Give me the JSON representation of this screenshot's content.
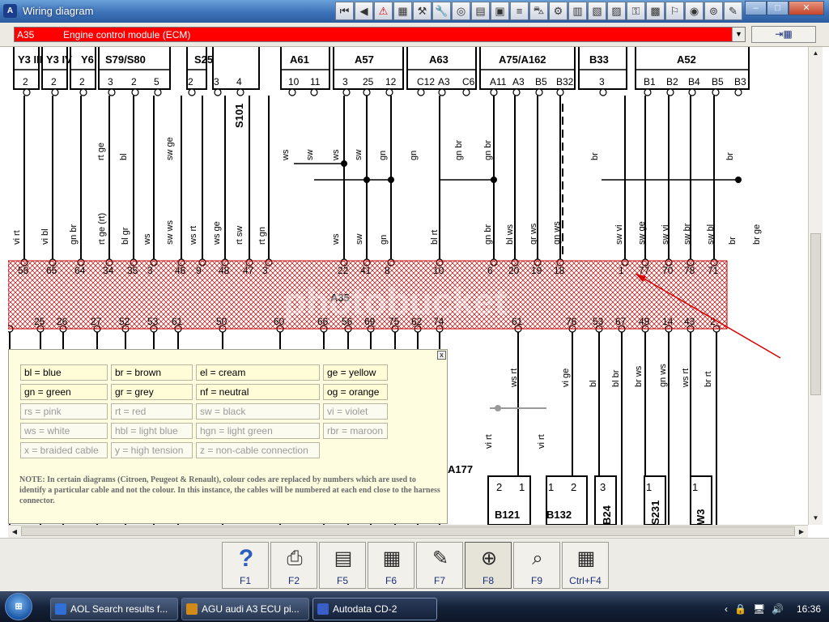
{
  "window": {
    "title": "Wiring diagram",
    "app_icon": "autodata-icon"
  },
  "toolbar_icons": [
    "first-icon",
    "prev-icon",
    "warning-icon",
    "map-icon",
    "tool-icon",
    "wrench-icon",
    "gauge-icon",
    "book-icon",
    "battery-icon",
    "filter-icon",
    "car-icon",
    "engine-icon",
    "manual-icon",
    "ecu-icon",
    "connector-icon",
    "key-icon",
    "diagram-icon",
    "service-icon",
    "brake-icon",
    "tyre-icon",
    "note-icon"
  ],
  "window_controls": {
    "minimize": "–",
    "maximize": "□",
    "close": "✕"
  },
  "component_select": {
    "code": "A35",
    "name": "Engine control module (ECM)",
    "arrow": "▼"
  },
  "exit_button": {
    "label": "⇥▦"
  },
  "diagram": {
    "ecu_label": "A35",
    "watermark": "photobucket",
    "top_headers": [
      {
        "text": "Y3 III"
      },
      {
        "text": "Y3 IV"
      },
      {
        "text": "Y6"
      },
      {
        "text": "S79/S80"
      },
      {
        "text": "S25"
      },
      {
        "text": "A61"
      },
      {
        "text": "A57"
      },
      {
        "text": "A63"
      },
      {
        "text": "A75/A162"
      },
      {
        "text": "B33"
      },
      {
        "text": "A52"
      }
    ],
    "side_label": "S101",
    "top_connector_pins": [
      "2",
      "2",
      "2",
      "3",
      "2",
      "5",
      "2",
      "3",
      "4",
      "10",
      "11",
      "3",
      "25",
      "12",
      "C12",
      "A3",
      "C6",
      "A11",
      "A3",
      "B5",
      "B32",
      "3",
      "B1",
      "B2",
      "B4",
      "B5",
      "B3"
    ],
    "upper_wire_colors": [
      "rt ge",
      "bl",
      "sw ge",
      "ws",
      "sw",
      "ws",
      "sw",
      "gn",
      "gn",
      "gn br",
      "gn br",
      "br",
      "br"
    ],
    "lower_wire_colors": [
      "vi rt",
      "vi bl",
      "gn br",
      "rt ge (rt)",
      "bl gr",
      "ws",
      "sw ws",
      "ws rt",
      "ws ge",
      "rt sw",
      "rt gn",
      "ws",
      "sw",
      "gn",
      "bl rt",
      "gn br",
      "bl ws",
      "gr ws",
      "gn ws",
      "sw vi",
      "sw ge",
      "sw vi",
      "sw br",
      "sw bl",
      "br",
      "br ge"
    ],
    "ecu_top_pins": [
      "58",
      "65",
      "64",
      "34",
      "35",
      "3",
      "46",
      "9",
      "48",
      "47",
      "3",
      "22",
      "41",
      "8",
      "10",
      "6",
      "20",
      "19",
      "18",
      "1",
      "77",
      "70",
      "78",
      "71"
    ],
    "ecu_bottom_pins": [
      "3",
      "25",
      "26",
      "27",
      "52",
      "53",
      "61",
      "50",
      "60",
      "66",
      "56",
      "69",
      "75",
      "62",
      "74",
      "61",
      "76",
      "53",
      "67",
      "49",
      "14",
      "43",
      "2"
    ],
    "below_wire_colors": [
      "ws rt",
      "vi ge",
      "bl",
      "bl br",
      "br ws",
      "gn ws",
      "ws rt",
      "br rt",
      "vi rt",
      "vi rt"
    ],
    "bottom_components": [
      "A177",
      "B121",
      "B132",
      "B24",
      "S231",
      "W3"
    ],
    "bottom_component_pins": [
      "2",
      "1",
      "1",
      "2",
      "3",
      "1",
      "1"
    ]
  },
  "legend": {
    "close": "x",
    "entries": [
      {
        "text": "bl = blue",
        "dim": false
      },
      {
        "text": "br = brown",
        "dim": false
      },
      {
        "text": "el = cream",
        "dim": false
      },
      {
        "text": "ge = yellow",
        "dim": false
      },
      {
        "text": "gn = green",
        "dim": false
      },
      {
        "text": "gr = grey",
        "dim": false
      },
      {
        "text": "nf = neutral",
        "dim": false
      },
      {
        "text": "og = orange",
        "dim": false
      },
      {
        "text": "rs = pink",
        "dim": true
      },
      {
        "text": "rt = red",
        "dim": true
      },
      {
        "text": "sw = black",
        "dim": true
      },
      {
        "text": "vi = violet",
        "dim": true
      },
      {
        "text": "ws = white",
        "dim": true
      },
      {
        "text": "hbl = light blue",
        "dim": true
      },
      {
        "text": "hgn = light green",
        "dim": true
      },
      {
        "text": "rbr = maroon",
        "dim": true
      },
      {
        "text": "x = braided cable",
        "dim": true
      },
      {
        "text": "y = high tension",
        "dim": true
      },
      {
        "text": "z = non-cable connection",
        "dim": true
      }
    ],
    "note": "NOTE: In certain diagrams (Citroen, Peugeot & Renault), colour codes are replaced by numbers which are used to identify a particular cable and not the colour. In this instance, the cables will be numbered at each end close to the harness connector."
  },
  "function_keys": [
    {
      "label": "F1",
      "icon": "help-icon",
      "glyph": "?"
    },
    {
      "label": "F2",
      "icon": "print-icon",
      "glyph": "⎙"
    },
    {
      "label": "F5",
      "icon": "printer-icon",
      "glyph": "▤"
    },
    {
      "label": "F6",
      "icon": "calculator-icon",
      "glyph": "▦"
    },
    {
      "label": "F7",
      "icon": "pen-icon",
      "glyph": "✎"
    },
    {
      "label": "F8",
      "icon": "zoom-icon",
      "glyph": "⊕"
    },
    {
      "label": "F9",
      "icon": "magnifier-icon",
      "glyph": "⌕"
    },
    {
      "label": "Ctrl+F4",
      "icon": "grid-icon",
      "glyph": "▦"
    }
  ],
  "taskbar": {
    "start": "⊞",
    "tasks": [
      {
        "label": "AOL Search results f...",
        "icon_color": "#2f6fd6"
      },
      {
        "label": "AGU audi A3 ECU pi...",
        "icon_color": "#d08a1a"
      },
      {
        "label": "Autodata CD-2",
        "icon_color": "#3a5ec8"
      }
    ],
    "tray": [
      "‹",
      "🔒",
      "🖥",
      "🔊"
    ],
    "clock": "16:36"
  },
  "colors": {
    "title_bar": "#3d72b8",
    "selector_red": "#ff0000",
    "ecu_hatch": "#c00000",
    "legend_bg": "#fefde0"
  }
}
